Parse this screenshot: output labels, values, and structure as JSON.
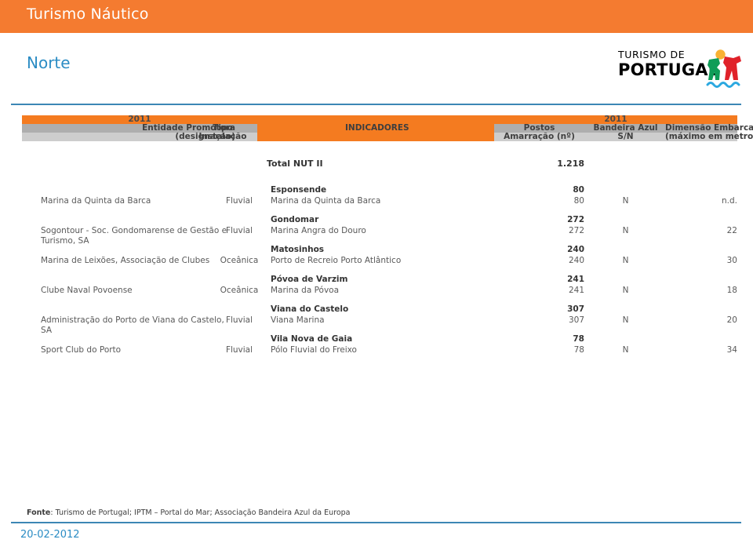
{
  "header": {
    "title": "Turismo Náutico",
    "region": "Norte",
    "bar_color": "#F47B30",
    "region_color": "#2B8CC4"
  },
  "logo": {
    "line1": "TURISMO DE",
    "line2": "PORTUGAL",
    "icon": "portugal-figure-logo"
  },
  "table": {
    "header": {
      "year_left": "2011",
      "entidade": "Entidade Promotora",
      "designacao": "(designação)",
      "tipo": "Tipo",
      "instalacao": "Instalação",
      "indicadores": "INDICADORES",
      "year_right": "2011",
      "postos": "Postos",
      "amarracao": "Amarração (nº)",
      "bandeira_azul": "Bandeira Azul",
      "sn": "S/N",
      "dimensao": "Dimensão Embarcação",
      "maximo": "(máximo em metros)"
    },
    "total": {
      "label": "Total NUT II",
      "value": "1.218"
    },
    "rows": [
      {
        "entity": "Marina da Quinta da Barca",
        "tipo": "Fluvial",
        "group": "Esponsende",
        "name": "Marina da Quinta da Barca",
        "postos_total": "80",
        "postos": "80",
        "bandeira": "N",
        "dimensao": "n.d."
      },
      {
        "entity": "Sogontour - Soc. Gondomarense de Gestão e Turismo, SA",
        "tipo": "Fluvial",
        "group": "Gondomar",
        "name": "Marina Angra do Douro",
        "postos_total": "272",
        "postos": "272",
        "bandeira": "N",
        "dimensao": "22"
      },
      {
        "entity": "Marina de Leixões, Associação de Clubes",
        "tipo": "Oceânica",
        "group": "Matosinhos",
        "name": "Porto de Recreio Porto Atlântico",
        "postos_total": "240",
        "postos": "240",
        "bandeira": "N",
        "dimensao": "30"
      },
      {
        "entity": "Clube Naval Povoense",
        "tipo": "Oceânica",
        "group": "Póvoa de Varzim",
        "name": "Marina da Póvoa",
        "postos_total": "241",
        "postos": "241",
        "bandeira": "N",
        "dimensao": "18"
      },
      {
        "entity": "Administração do Porto de Viana do Castelo, SA",
        "tipo": "Fluvial",
        "group": "Viana do Castelo",
        "name": "Viana Marina",
        "postos_total": "307",
        "postos": "307",
        "bandeira": "N",
        "dimensao": "20"
      },
      {
        "entity": "Sport Club do Porto",
        "tipo": "Fluvial",
        "group": "Vila Nova de Gaia",
        "name": "Pólo Fluvial do Freixo",
        "postos_total": "78",
        "postos": "78",
        "bandeira": "N",
        "dimensao": "34"
      }
    ]
  },
  "footer": {
    "source_label": "Fonte",
    "source_text": ": Turismo de Portugal; IPTM – Portal do Mar; Associação Bandeira Azul da Europa",
    "date": "20-02-2012"
  }
}
